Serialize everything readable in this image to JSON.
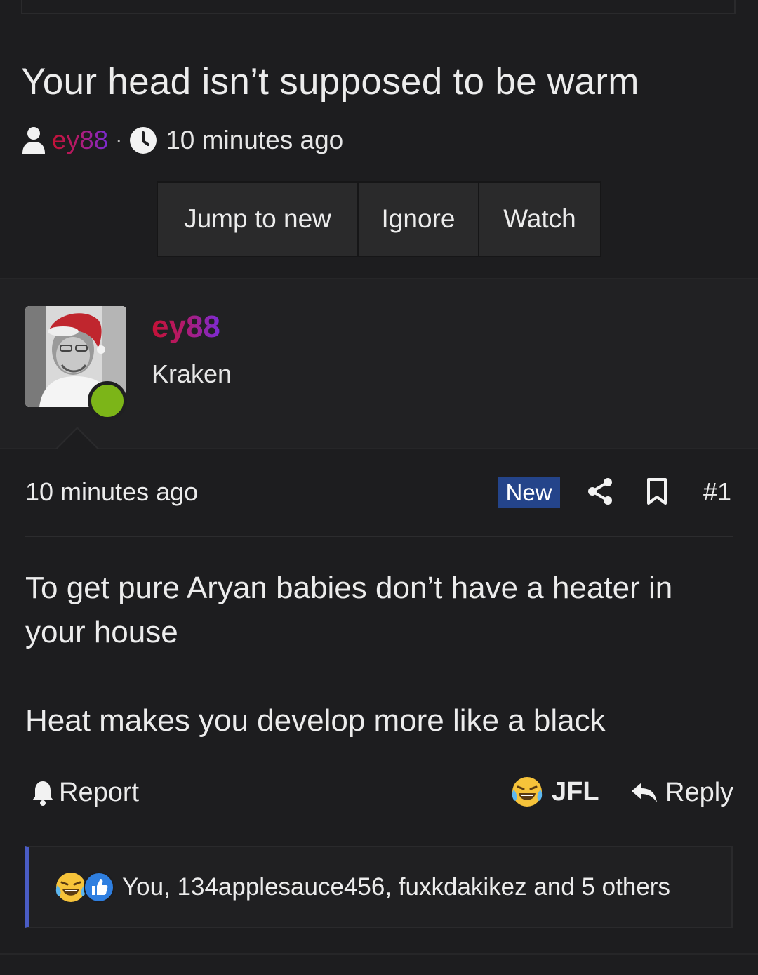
{
  "thread": {
    "title": "Your head isn’t supposed to be warm",
    "author": "ey88",
    "separator": "·",
    "time": "10 minutes ago",
    "icons": {
      "author": "user-icon",
      "time": "clock-icon"
    }
  },
  "thread_actions": {
    "jump": "Jump to new",
    "ignore": "Ignore",
    "watch": "Watch"
  },
  "post": {
    "username": "ey88",
    "user_title": "Kraken",
    "online": true,
    "time": "10 minutes ago",
    "badge": "New",
    "number": "#1",
    "body": [
      "To get pure Aryan babies don’t have a heater in your house",
      "Heat makes you develop more like a black"
    ],
    "actions": {
      "report": "Report",
      "jfl": "JFL",
      "reply": "Reply"
    },
    "reactions_summary": "You, 134applesauce456, fuxkdakikez and 5 others",
    "reaction_icons": [
      "laugh-emoji-icon",
      "like-icon"
    ]
  },
  "colors": {
    "background": "#1d1d1f",
    "username_gradient_start": "#c41236",
    "username_gradient_end": "#7b2bd6",
    "new_badge": "#24448a",
    "online_dot": "#7cb518",
    "reaction_accent": "#4a5cc4"
  }
}
